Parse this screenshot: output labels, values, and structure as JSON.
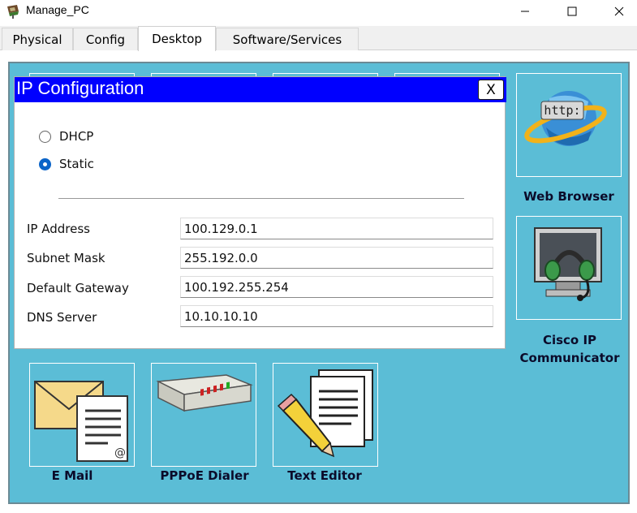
{
  "window": {
    "title": "Manage_PC"
  },
  "tabs": [
    {
      "label": "Physical",
      "active": false
    },
    {
      "label": "Config",
      "active": false
    },
    {
      "label": "Desktop",
      "active": true
    },
    {
      "label": "Software/Services",
      "active": false
    }
  ],
  "desktop": {
    "apps": [
      {
        "label": "Web Browser",
        "icon": "web-browser-icon"
      },
      {
        "label": "Cisco IP\nCommunicator",
        "icon": "headset-monitor-icon"
      },
      {
        "label": "E Mail",
        "icon": "email-icon"
      },
      {
        "label": "PPPoE Dialer",
        "icon": "pppoe-dialer-icon"
      },
      {
        "label": "Text Editor",
        "icon": "text-editor-icon"
      }
    ]
  },
  "ip_config": {
    "title": "IP Configuration",
    "close_label": "X",
    "mode_options": [
      {
        "label": "DHCP",
        "checked": false
      },
      {
        "label": "Static",
        "checked": true
      }
    ],
    "fields": [
      {
        "label": "IP Address",
        "value": "100.129.0.1"
      },
      {
        "label": "Subnet Mask",
        "value": "255.192.0.0"
      },
      {
        "label": "Default Gateway",
        "value": "100.192.255.254"
      },
      {
        "label": "DNS Server",
        "value": "10.10.10.10"
      }
    ]
  },
  "colors": {
    "desktop_bg": "#5bbdd6",
    "dialog_title_bg": "#0000ff",
    "radio_accent": "#0a64c8"
  }
}
